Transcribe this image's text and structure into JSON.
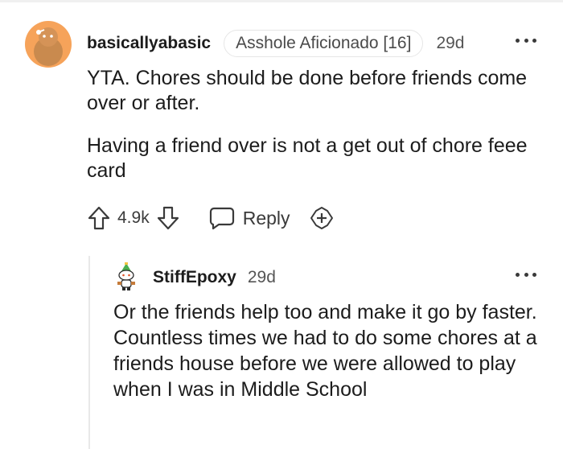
{
  "parent_comment": {
    "username": "basicallyabasic",
    "flair": "Asshole Aficionado [16]",
    "timestamp": "29d",
    "paragraphs": [
      "YTA. Chores should be done before friends come over or after.",
      "Having a friend over is not a get out of chore feee card"
    ],
    "vote_count": "4.9k",
    "reply_label": "Reply",
    "avatar_color": "#f6a35a",
    "icons": [
      "avatar-snoo-icon",
      "more-options-icon",
      "upvote-icon",
      "downvote-icon",
      "reply-bubble-icon",
      "award-plus-icon"
    ]
  },
  "reply_comment": {
    "username": "StiffEpoxy",
    "timestamp": "29d",
    "body": "Or the friends help too and make it go by faster. Countless times we had to do some chores at a friends house before we were allowed to play when I was in Middle School",
    "icons": [
      "avatar-snoo-icon",
      "more-options-icon"
    ]
  }
}
